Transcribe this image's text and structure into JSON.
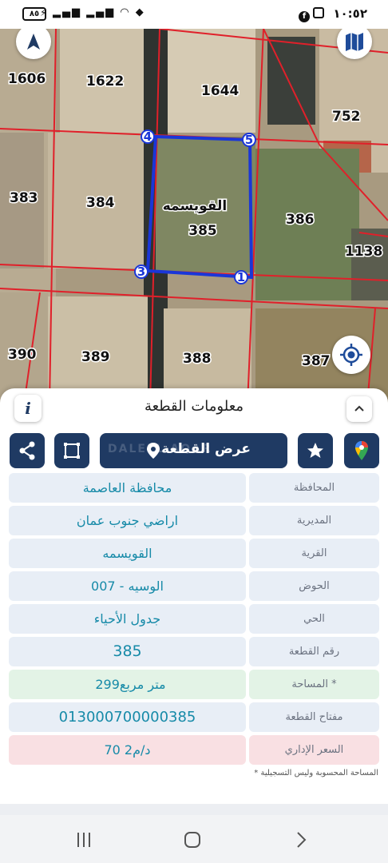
{
  "status_bar": {
    "time": "١٠:٥٢",
    "battery": "٨٥"
  },
  "map": {
    "parcels": [
      {
        "label": "1606"
      },
      {
        "label": "1622"
      },
      {
        "label": "1644"
      },
      {
        "label": "752"
      },
      {
        "label": "383"
      },
      {
        "label": "384"
      },
      {
        "label": "386"
      },
      {
        "label": "1138"
      },
      {
        "label": "390"
      },
      {
        "label": "389"
      },
      {
        "label": "388"
      },
      {
        "label": "387"
      }
    ],
    "selected": {
      "village": "القويسمه",
      "number": "385"
    },
    "corners": [
      "1",
      "3",
      "4",
      "5"
    ]
  },
  "panel": {
    "title": "معلومات القطعة",
    "info_label": "i",
    "show_plot_label": "عرض القطعة",
    "watermark": "DALEEL AQAR",
    "rows": [
      {
        "label": "المحافظة",
        "value": "محافظة العاصمة"
      },
      {
        "label": "المديرية",
        "value": "اراضي جنوب عمان"
      },
      {
        "label": "القرية",
        "value": "القويسمه"
      },
      {
        "label": "الحوض",
        "value": "الوسيه - 007"
      },
      {
        "label": "الحي",
        "value": "جدول الأحياء"
      },
      {
        "label": "رقم القطعة",
        "value": "385"
      },
      {
        "label": "المساحة *",
        "value_unit": "متر مربع",
        "value_num": "299"
      },
      {
        "label": "مفتاح القطعة",
        "value": "013000700000385"
      },
      {
        "label": "السعر الإداري",
        "value": "70 د/م2"
      }
    ],
    "footnote": "* المساحة المحسوبة وليس التسجيلية"
  },
  "colors": {
    "primary": "#1f3a63",
    "value_text": "#168aa8",
    "row_bg": "#e8eef6",
    "area_bg": "#e3f3e6",
    "price_bg": "#f9e0e3",
    "plot_outline": "#1a36d8",
    "parcel_lines": "#e0202a"
  }
}
